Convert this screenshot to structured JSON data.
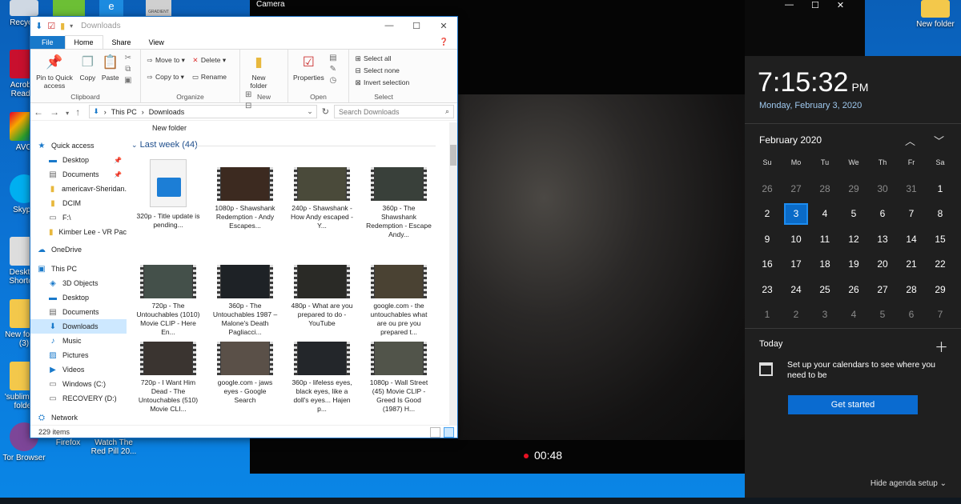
{
  "desktop": {
    "icons": [
      {
        "label": "Recycle"
      },
      {
        "label": "Acrobat Reader"
      },
      {
        "label": "AVG"
      },
      {
        "label": "Skype"
      },
      {
        "label": "Desktop Shortcut"
      },
      {
        "label": "New folder (3)"
      },
      {
        "label": "'subliminal' folder"
      },
      {
        "label": "Tor Browser"
      },
      {
        "label": "Firefox"
      },
      {
        "label": "Watch The Red Pill 20..."
      },
      {
        "label": "New folder"
      }
    ],
    "top_icon_label": "GRADIENT"
  },
  "camera": {
    "title": "Camera",
    "timer": "00:48"
  },
  "explorer": {
    "title": "Downloads",
    "tabs": {
      "file": "File",
      "home": "Home",
      "share": "Share",
      "view": "View"
    },
    "ribbon": {
      "clipboard": {
        "label": "Clipboard",
        "pin": "Pin to Quick access",
        "copy": "Copy",
        "paste": "Paste"
      },
      "organize": {
        "label": "Organize",
        "move_to": "Move to",
        "copy_to": "Copy to",
        "delete": "Delete",
        "rename": "Rename"
      },
      "new": {
        "label": "New",
        "new_folder": "New folder"
      },
      "open": {
        "label": "Open",
        "properties": "Properties"
      },
      "select": {
        "label": "Select",
        "select_all": "Select all",
        "select_none": "Select none",
        "invert": "Invert selection"
      }
    },
    "address": {
      "segment1": "This PC",
      "segment2": "Downloads"
    },
    "search_placeholder": "Search Downloads",
    "nav": {
      "quick_access": "Quick access",
      "desktop": "Desktop",
      "documents": "Documents",
      "americavr": "americavr-Sheridan.",
      "dcim": "DCIM",
      "f_drive": "F:\\",
      "kimber": "Kimber Lee - VR Pac",
      "onedrive": "OneDrive",
      "this_pc": "This PC",
      "objects3d": "3D Objects",
      "desktop2": "Desktop",
      "documents2": "Documents",
      "downloads": "Downloads",
      "music": "Music",
      "pictures": "Pictures",
      "videos": "Videos",
      "windows_c": "Windows (C:)",
      "recovery_d": "RECOVERY (D:)",
      "network": "Network"
    },
    "content": {
      "new_folder": "New folder",
      "group": "Last week (44)",
      "items": [
        {
          "name": "320p - Title update is pending..."
        },
        {
          "name": "1080p - Shawshank Redemption - Andy Escapes..."
        },
        {
          "name": "240p - Shawshank - How Andy escaped - Y..."
        },
        {
          "name": "360p - The Shawshank Redemption - Escape Andy..."
        },
        {
          "name": "720p - The Untouchables (1010) Movie CLIP - Here En..."
        },
        {
          "name": "360p - The Untouchables 1987 – Malone's Death Pagliacci..."
        },
        {
          "name": "480p - What are you prepared to do - YouTube"
        },
        {
          "name": "google.com - the untouchables what are ou pre you prepared t..."
        },
        {
          "name": "720p - I Want Him Dead - The Untouchables (510) Movie CLI..."
        },
        {
          "name": "google.com - jaws eyes - Google Search"
        },
        {
          "name": "360p - lifeless eyes, black eyes, like a doll's eyes... Hajen p..."
        },
        {
          "name": "1080p - Wall Street (45) Movie CLIP - Greed Is Good (1987) H..."
        }
      ]
    },
    "status": "229 items"
  },
  "calendar": {
    "time": "7:15:32",
    "ampm": "PM",
    "date": "Monday, February 3, 2020",
    "month": "February 2020",
    "weekdays": [
      "Su",
      "Mo",
      "Tu",
      "We",
      "Th",
      "Fr",
      "Sa"
    ],
    "days": [
      "26",
      "27",
      "28",
      "29",
      "30",
      "31",
      "1",
      "2",
      "3",
      "4",
      "5",
      "6",
      "7",
      "8",
      "9",
      "10",
      "11",
      "12",
      "13",
      "14",
      "15",
      "16",
      "17",
      "18",
      "19",
      "20",
      "21",
      "22",
      "23",
      "24",
      "25",
      "26",
      "27",
      "28",
      "29",
      "1",
      "2",
      "3",
      "4",
      "5",
      "6",
      "7"
    ],
    "today_label": "Today",
    "setup_text": "Set up your calendars to see where you need to be",
    "get_started": "Get started",
    "hide_agenda": "Hide agenda setup"
  }
}
